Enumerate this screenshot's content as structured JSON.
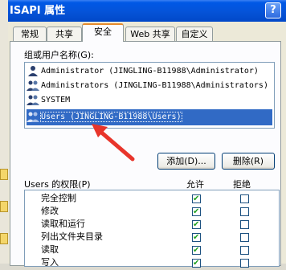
{
  "window": {
    "title": "ISAPI 属性",
    "help_glyph": "?"
  },
  "tabs": [
    {
      "label": "常规"
    },
    {
      "label": "共享"
    },
    {
      "label": "安全"
    },
    {
      "label": "Web 共享"
    },
    {
      "label": "自定义"
    }
  ],
  "security": {
    "group_label": "组或用户名称(G):",
    "principals": [
      {
        "name": "Administrator (JINGLING-B11988\\Administrator)",
        "icon": "user-icon"
      },
      {
        "name": "Administrators (JINGLING-B11988\\Administrators)",
        "icon": "group-icon"
      },
      {
        "name": "SYSTEM",
        "icon": "group-icon"
      },
      {
        "name": "Users (JINGLING-B11988\\Users)",
        "icon": "group-icon",
        "selected": true
      }
    ],
    "add_label": "添加(D)...",
    "remove_label": "删除(R)",
    "perm_label": "Users 的权限(P)",
    "allow_label": "允许",
    "deny_label": "拒绝",
    "permissions": [
      {
        "name": "完全控制",
        "allow": true,
        "deny": false
      },
      {
        "name": "修改",
        "allow": true,
        "deny": false
      },
      {
        "name": "读取和运行",
        "allow": true,
        "deny": false
      },
      {
        "name": "列出文件夹目录",
        "allow": true,
        "deny": false
      },
      {
        "name": "读取",
        "allow": true,
        "deny": false
      },
      {
        "name": "写入",
        "allow": true,
        "deny": false
      }
    ]
  },
  "colors": {
    "selection": "#316ac5",
    "annotation_arrow": "#e8352b"
  }
}
